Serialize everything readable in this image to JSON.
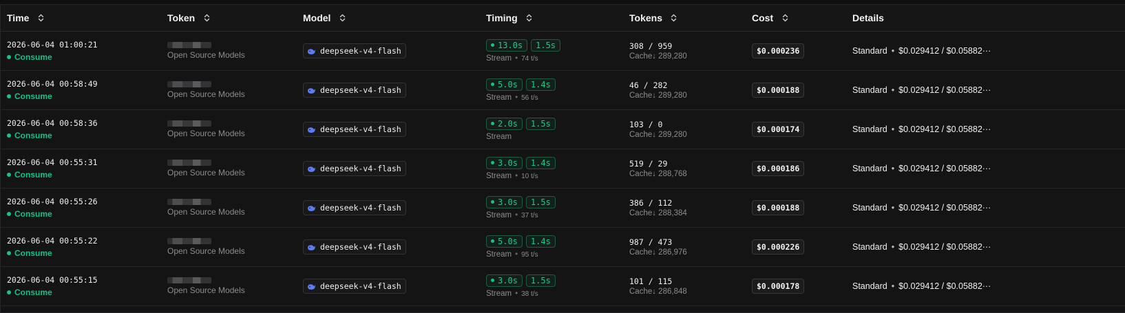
{
  "headers": {
    "time": "Time",
    "token": "Token",
    "model": "Model",
    "timing": "Timing",
    "tokens": "Tokens",
    "cost": "Cost",
    "details": "Details"
  },
  "icons": {
    "sort": "sort-icon",
    "model": "whale-icon",
    "status": "dot-icon"
  },
  "colors": {
    "accent_green": "#19c08a",
    "background": "#141415"
  },
  "rows": [
    {
      "time": "2026-06-04 01:00:21",
      "status": "Consume",
      "token_group": "Open Source Models",
      "model": "deepseek-v4-flash",
      "timing_total": "13.0s",
      "timing_first": "1.5s",
      "stream": "Stream",
      "rate": "74 t/s",
      "tokens": "308 / 959",
      "cache": "Cache↓ 289,280",
      "cost": "$0.000236",
      "details_tier": "Standard",
      "details_price": "$0.029412 / $0.05882···"
    },
    {
      "time": "2026-06-04 00:58:49",
      "status": "Consume",
      "token_group": "Open Source Models",
      "model": "deepseek-v4-flash",
      "timing_total": "5.0s",
      "timing_first": "1.4s",
      "stream": "Stream",
      "rate": "56 t/s",
      "tokens": "46 / 282",
      "cache": "Cache↓ 289,280",
      "cost": "$0.000188",
      "details_tier": "Standard",
      "details_price": "$0.029412 / $0.05882···"
    },
    {
      "time": "2026-06-04 00:58:36",
      "status": "Consume",
      "token_group": "Open Source Models",
      "model": "deepseek-v4-flash",
      "timing_total": "2.0s",
      "timing_first": "1.5s",
      "stream": "Stream",
      "rate": null,
      "tokens": "103 / 0",
      "cache": "Cache↓ 289,280",
      "cost": "$0.000174",
      "details_tier": "Standard",
      "details_price": "$0.029412 / $0.05882···"
    },
    {
      "time": "2026-06-04 00:55:31",
      "status": "Consume",
      "token_group": "Open Source Models",
      "model": "deepseek-v4-flash",
      "timing_total": "3.0s",
      "timing_first": "1.4s",
      "stream": "Stream",
      "rate": "10 t/s",
      "tokens": "519 / 29",
      "cache": "Cache↓ 288,768",
      "cost": "$0.000186",
      "details_tier": "Standard",
      "details_price": "$0.029412 / $0.05882···"
    },
    {
      "time": "2026-06-04 00:55:26",
      "status": "Consume",
      "token_group": "Open Source Models",
      "model": "deepseek-v4-flash",
      "timing_total": "3.0s",
      "timing_first": "1.5s",
      "stream": "Stream",
      "rate": "37 t/s",
      "tokens": "386 / 112",
      "cache": "Cache↓ 288,384",
      "cost": "$0.000188",
      "details_tier": "Standard",
      "details_price": "$0.029412 / $0.05882···"
    },
    {
      "time": "2026-06-04 00:55:22",
      "status": "Consume",
      "token_group": "Open Source Models",
      "model": "deepseek-v4-flash",
      "timing_total": "5.0s",
      "timing_first": "1.4s",
      "stream": "Stream",
      "rate": "95 t/s",
      "tokens": "987 / 473",
      "cache": "Cache↓ 286,976",
      "cost": "$0.000226",
      "details_tier": "Standard",
      "details_price": "$0.029412 / $0.05882···"
    },
    {
      "time": "2026-06-04 00:55:15",
      "status": "Consume",
      "token_group": "Open Source Models",
      "model": "deepseek-v4-flash",
      "timing_total": "3.0s",
      "timing_first": "1.5s",
      "stream": "Stream",
      "rate": "38 t/s",
      "tokens": "101 / 115",
      "cache": "Cache↓ 286,848",
      "cost": "$0.000178",
      "details_tier": "Standard",
      "details_price": "$0.029412 / $0.05882···"
    }
  ]
}
